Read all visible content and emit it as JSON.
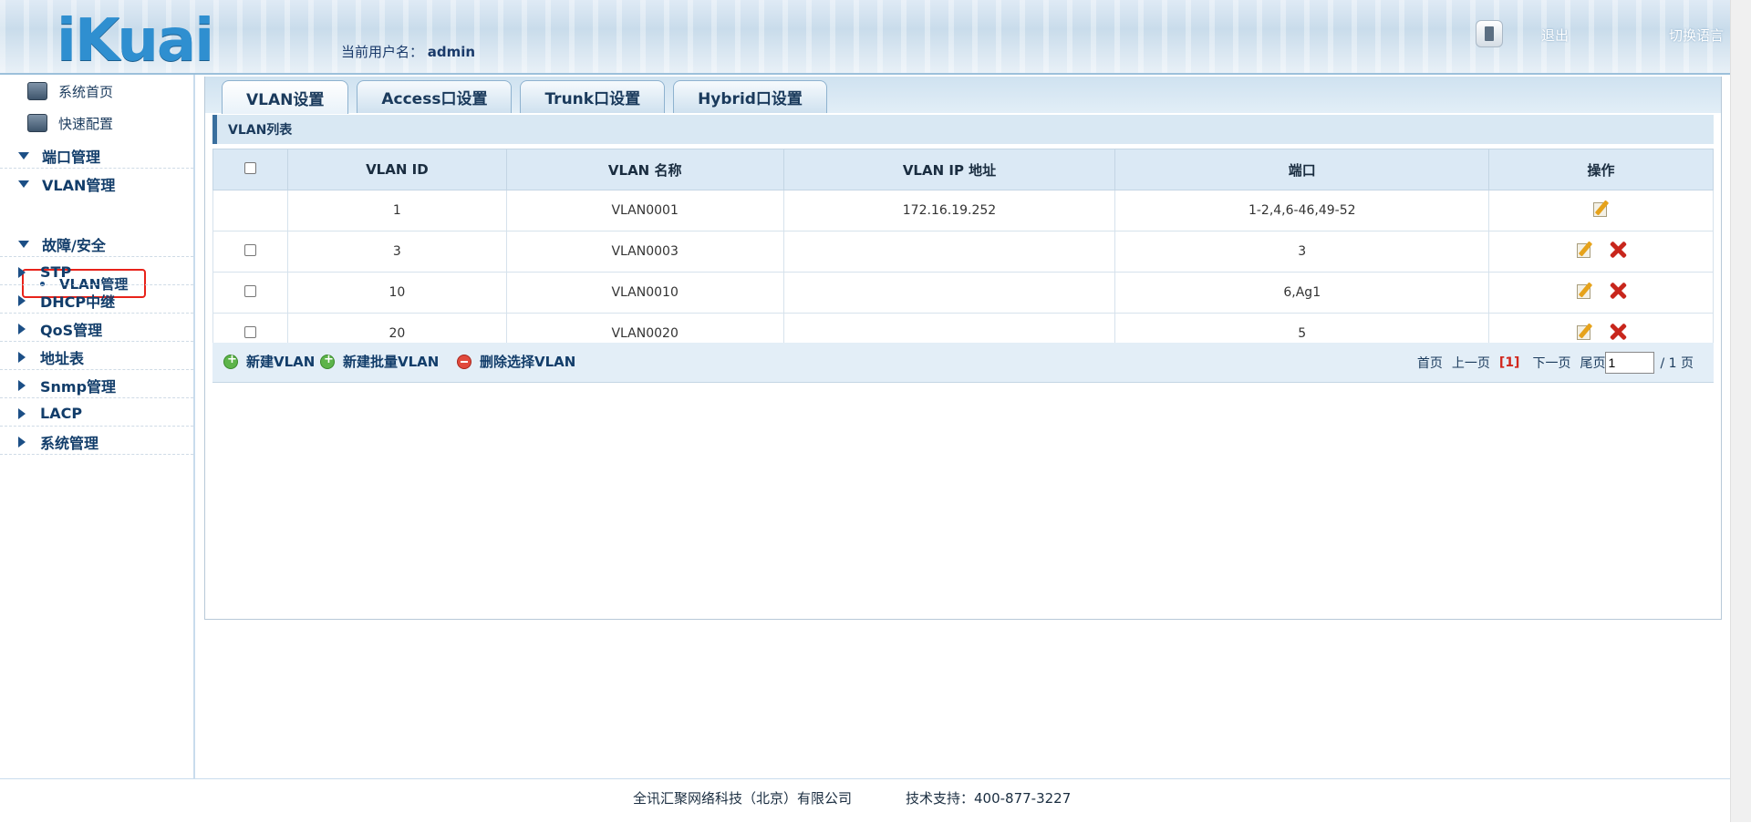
{
  "header": {
    "logo": "iKuai",
    "user_label": "当前用户名：",
    "username": "admin",
    "logout_label": "退出",
    "language_label": "切换语言"
  },
  "sidebar": {
    "top_items": [
      {
        "label": "系统首页",
        "icon": "monitor-icon"
      },
      {
        "label": "快速配置",
        "icon": "config-icon"
      }
    ],
    "menu": [
      {
        "label": "端口管理",
        "expanded": true
      },
      {
        "label": "VLAN管理",
        "expanded": true
      },
      {
        "label": "故障/安全",
        "expanded": true
      },
      {
        "label": "STP",
        "expanded": false
      },
      {
        "label": "DHCP中继",
        "expanded": false
      },
      {
        "label": "QoS管理",
        "expanded": false
      },
      {
        "label": "地址表",
        "expanded": false
      },
      {
        "label": "Snmp管理",
        "expanded": false
      },
      {
        "label": "LACP",
        "expanded": false
      },
      {
        "label": "系统管理",
        "expanded": false
      }
    ],
    "active_sub_item": "VLAN管理"
  },
  "tabs": [
    {
      "label": "VLAN设置",
      "active": true
    },
    {
      "label": "Access口设置",
      "active": false
    },
    {
      "label": "Trunk口设置",
      "active": false
    },
    {
      "label": "Hybrid口设置",
      "active": false
    }
  ],
  "list_title": "VLAN列表",
  "table": {
    "columns": [
      "VLAN ID",
      "VLAN 名称",
      "VLAN IP 地址",
      "端口",
      "操作"
    ],
    "rows": [
      {
        "id": "1",
        "name": "VLAN0001",
        "ip": "172.16.19.252",
        "ports": "1-2,4,6-46,49-52",
        "selectable": false,
        "deletable": false
      },
      {
        "id": "3",
        "name": "VLAN0003",
        "ip": "",
        "ports": "3",
        "selectable": true,
        "deletable": true
      },
      {
        "id": "10",
        "name": "VLAN0010",
        "ip": "",
        "ports": "6,Ag1",
        "selectable": true,
        "deletable": true
      },
      {
        "id": "20",
        "name": "VLAN0020",
        "ip": "",
        "ports": "5",
        "selectable": true,
        "deletable": true
      }
    ]
  },
  "toolbar": {
    "new_vlan": "新建VLAN",
    "batch_new_vlan": "新建批量VLAN",
    "delete_selected": "删除选择VLAN"
  },
  "pager": {
    "first": "首页",
    "prev": "上一页",
    "current": "[1]",
    "next": "下一页",
    "last": "尾页",
    "page_input": "1",
    "total": "/ 1 页"
  },
  "footer": {
    "company": "全讯汇聚网络科技（北京）有限公司",
    "support": "技术支持：400-877-3227"
  },
  "colors": {
    "accent": "#123d6a",
    "highlight_box": "#e8231a",
    "delete": "#c8261c"
  }
}
